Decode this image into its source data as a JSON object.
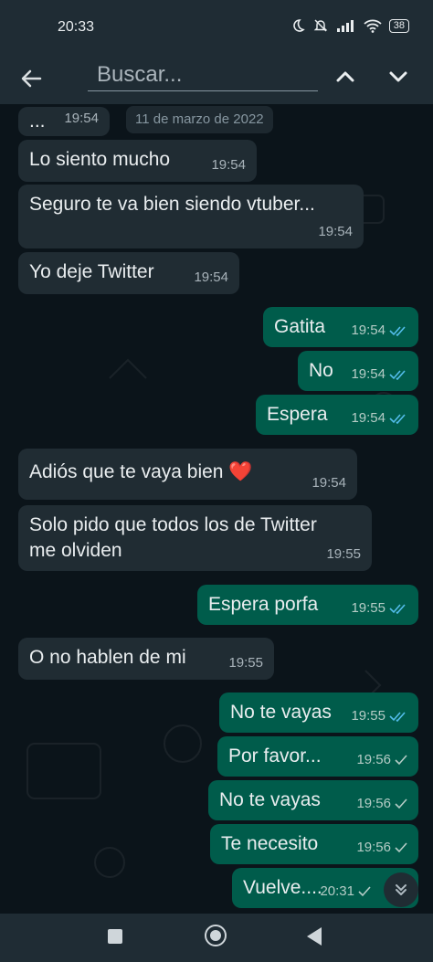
{
  "status_bar": {
    "time": "20:33",
    "battery": "38",
    "icons": [
      "moon-icon",
      "bell-off-icon",
      "signal-icon",
      "wifi-icon",
      "battery-icon"
    ]
  },
  "search_bar": {
    "placeholder": "Buscar..."
  },
  "chat": {
    "date_chip": "11 de marzo de 2022",
    "messages": [
      {
        "dir": "in",
        "text": "...",
        "time": "19:54"
      },
      {
        "dir": "in",
        "text": "Lo siento mucho",
        "time": "19:54"
      },
      {
        "dir": "in",
        "text": "Seguro te va bien siendo vtuber...",
        "time": "19:54"
      },
      {
        "dir": "in",
        "text": "Yo deje Twitter",
        "time": "19:54"
      },
      {
        "dir": "out",
        "text": "Gatita",
        "time": "19:54",
        "status": "read"
      },
      {
        "dir": "out",
        "text": "No",
        "time": "19:54",
        "status": "read"
      },
      {
        "dir": "out",
        "text": "Espera",
        "time": "19:54",
        "status": "read"
      },
      {
        "dir": "in",
        "text": "Adiós  que te vaya bien ❤️",
        "time": "19:54"
      },
      {
        "dir": "in",
        "text": "Solo pido que todos los de Twitter me olviden",
        "time": "19:55"
      },
      {
        "dir": "out",
        "text": "Espera porfa",
        "time": "19:55",
        "status": "read"
      },
      {
        "dir": "in",
        "text": "O no hablen de mi",
        "time": "19:55"
      },
      {
        "dir": "out",
        "text": "No te vayas",
        "time": "19:55",
        "status": "read"
      },
      {
        "dir": "out",
        "text": "Por favor...",
        "time": "19:56",
        "status": "sent"
      },
      {
        "dir": "out",
        "text": "No te vayas",
        "time": "19:56",
        "status": "sent"
      },
      {
        "dir": "out",
        "text": "Te necesito",
        "time": "19:56",
        "status": "sent"
      },
      {
        "dir": "out",
        "text": "Vuelve....",
        "time": "20:31",
        "status": "sent"
      }
    ]
  },
  "colors": {
    "header_bg": "#1f2c34",
    "chat_bg": "#0b141a",
    "incoming_bubble": "#202c33",
    "outgoing_bubble": "#005c4b",
    "read_tick": "#53bdeb",
    "sent_tick": "#b5ccc6"
  }
}
